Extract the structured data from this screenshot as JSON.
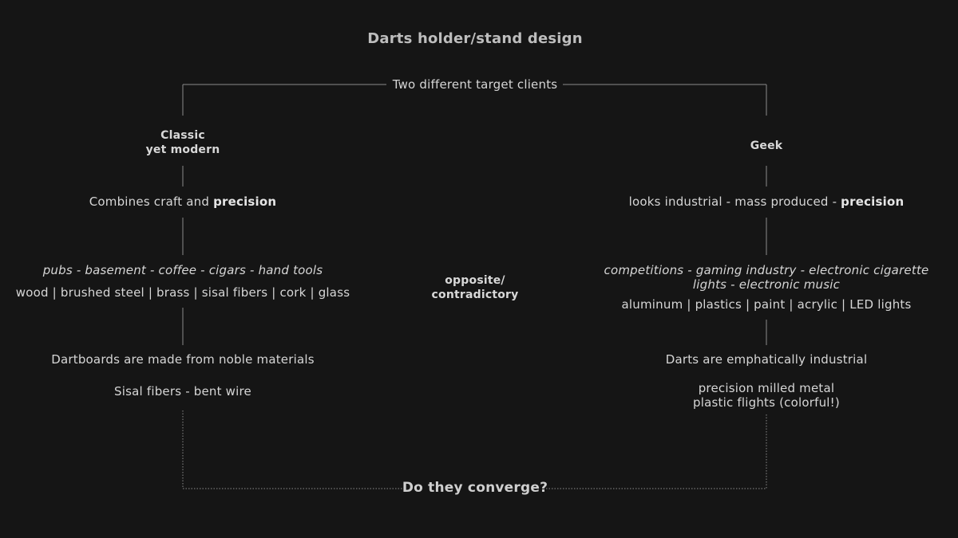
{
  "title": "Darts holder/stand design",
  "top_label": "Two different target clients",
  "left": {
    "heading_line1": "Classic",
    "heading_line2": "yet modern",
    "trait_prefix": "Combines craft and ",
    "trait_bold": "precision",
    "context": "pubs - basement - coffee - cigars - hand tools",
    "materials": "wood | brushed steel | brass | sisal fibers | cork | glass",
    "note1": "Dartboards are made from noble materials",
    "note2": "Sisal fibers - bent wire"
  },
  "right": {
    "heading": "Geek",
    "trait_prefix": "looks industrial - mass produced - ",
    "trait_bold": "precision",
    "context_line1": "competitions - gaming industry - electronic cigarette",
    "context_line2": "lights - electronic music",
    "materials": "aluminum | plastics | paint | acrylic | LED lights",
    "note1": "Darts are emphatically industrial",
    "note2_line1": "precision milled metal",
    "note2_line2": "plastic flights (colorful!)"
  },
  "center": {
    "line1": "opposite/",
    "line2": "contradictory"
  },
  "bottom_label": "Do they converge?",
  "colors": {
    "background": "#151515",
    "text": "#d6d6d6",
    "line": "#8a8a8a"
  }
}
